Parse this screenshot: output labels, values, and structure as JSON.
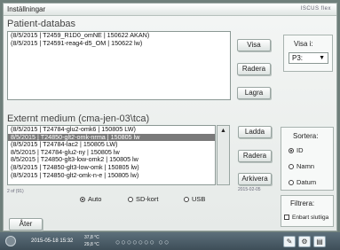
{
  "window": {
    "title": "Inställningar",
    "brand": "ISCUS flex"
  },
  "patient_db": {
    "title": "Patient-databas",
    "items": [
      "(8/5/2015 | T2459_R1D0_omNE | 150622 AKAN)",
      "(8/5/2015 | T24591-reag4-d5_OM | 150622 lw)"
    ],
    "buttons": {
      "show": "Visa",
      "delete": "Radera",
      "save": "Lagra"
    },
    "show_in": {
      "label": "Visa i:",
      "value": "P3:"
    }
  },
  "external": {
    "title": "Externt medium (cma-jen-03\\tca)",
    "items": [
      "(8/5/2015 | T24784-glu2-omk6 | 150805 LW)",
      "8/5/2015 | T24850-glt2-omk-nrma | 150805 lw",
      "(8/5/2015 | T24784-lac2 | 150805 LW)",
      "8/5/2015 | T24784-glu2-ny | 150805 lw",
      "8/5/2015 | T24850-glt3-low-omk2 | 150805 lw",
      "(8/5/2015 | T24850-glt3-low-omk | 150805 lw)",
      "(8/5/2015 | T24850-glt2-omk-n-e | 150805 lw)"
    ],
    "selected_index": 1,
    "count_text": "2 of (91)",
    "buttons": {
      "load": "Ladda",
      "delete": "Radera",
      "archive": "Arkivera"
    },
    "archive_date": "2015-02-05",
    "media": {
      "auto": "Auto",
      "sd": "SD-kort",
      "usb": "USB",
      "selected": "Auto"
    },
    "sort": {
      "label": "Sortera:",
      "id": "ID",
      "name": "Namn",
      "date": "Datum",
      "selected": "ID"
    }
  },
  "filter": {
    "label": "Filtrera:",
    "only_finals": "Enbart slutliga"
  },
  "back_button": "Åter",
  "taskbar": {
    "datetime": "2015-05-18 15:32",
    "temp1": "37,8 °C",
    "temp2": "29,8 °C",
    "circles": "○○○○○○○ ○○"
  }
}
